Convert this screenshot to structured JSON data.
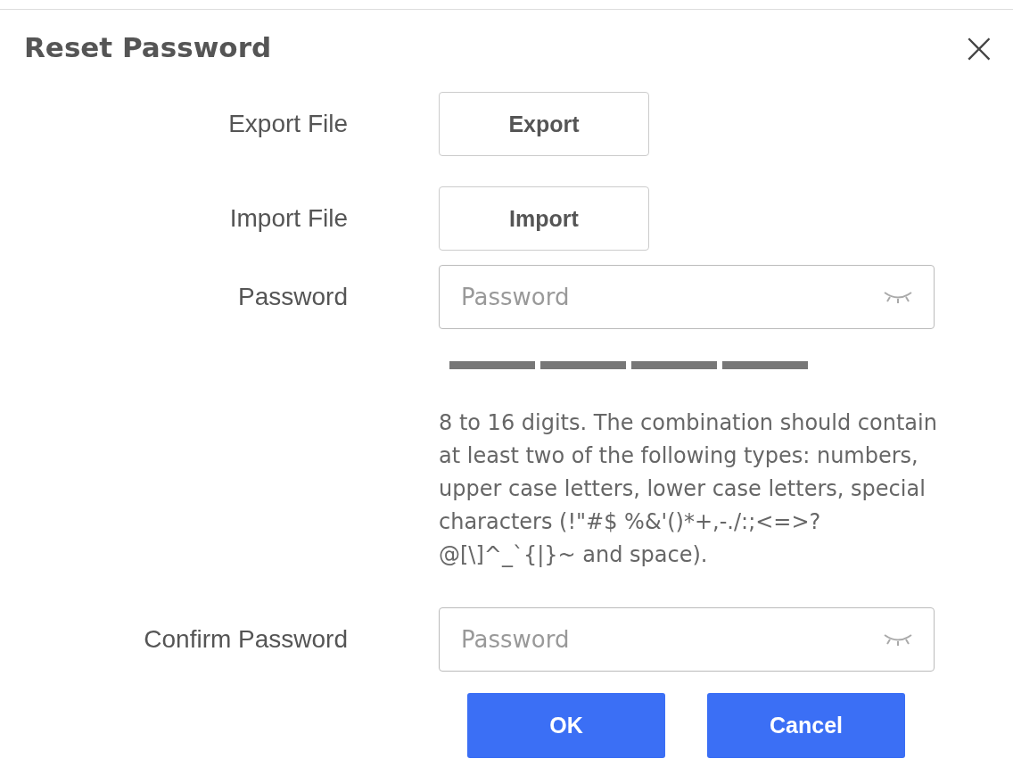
{
  "dialog": {
    "title": "Reset Password",
    "close": "×"
  },
  "rows": [
    {
      "kind": "button",
      "label": "Export File",
      "button": "Export"
    },
    {
      "kind": "button",
      "label": "Import File",
      "button": "Import"
    },
    {
      "kind": "password",
      "label": "Password",
      "placeholder": "Password",
      "strength_meter": true,
      "hint": "8 to 16 digits. The combination should contain at least two of the following types: numbers, upper case letters, lower case letters, special characters (!\"#$ %&'()*+,-./:;<=>?@[\\]^_`{|}~ and space)."
    },
    {
      "kind": "password",
      "label": "Confirm Password",
      "placeholder": "Password",
      "strength_meter": false
    }
  ],
  "buttons": [
    "OK",
    "Cancel"
  ]
}
